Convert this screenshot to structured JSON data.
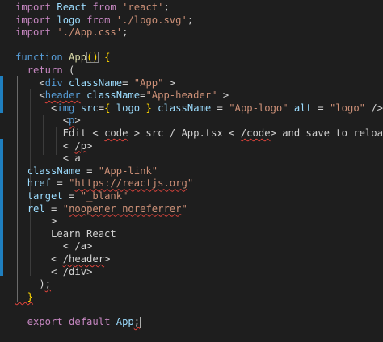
{
  "editor": {
    "language": "tsx",
    "colors": {
      "background": "#1e1e1e",
      "keyword_flow": "#c586c0",
      "keyword": "#569cd6",
      "string": "#ce9178",
      "function": "#dcdcaa",
      "attribute": "#9cdcfe",
      "text": "#d4d4d4",
      "error_squiggle": "#e0443c",
      "gutter_modified": "#1f7fbf"
    },
    "lines": [
      [
        {
          "t": "import ",
          "c": "kw-flow"
        },
        {
          "t": "React ",
          "c": "var"
        },
        {
          "t": "from ",
          "c": "kw-flow"
        },
        {
          "t": "'react'",
          "c": "str"
        },
        {
          "t": ";",
          "c": "punct"
        }
      ],
      [
        {
          "t": "import ",
          "c": "kw-flow"
        },
        {
          "t": "logo ",
          "c": "var"
        },
        {
          "t": "from ",
          "c": "kw-flow"
        },
        {
          "t": "'./logo.svg'",
          "c": "str"
        },
        {
          "t": ";",
          "c": "punct"
        }
      ],
      [
        {
          "t": "import ",
          "c": "kw-flow"
        },
        {
          "t": "'./App.css'",
          "c": "str"
        },
        {
          "t": ";",
          "c": "punct"
        }
      ],
      [],
      [
        {
          "t": "function ",
          "c": "kw"
        },
        {
          "t": "App",
          "c": "fn"
        },
        {
          "t": "()",
          "c": "brk bracket-match"
        },
        {
          "t": " ",
          "c": "txt"
        },
        {
          "t": "{",
          "c": "brk"
        }
      ],
      [
        {
          "t": "  return ",
          "c": "kw-flow"
        },
        {
          "t": "(",
          "c": "punct"
        }
      ],
      [
        {
          "t": "    <",
          "c": "punct"
        },
        {
          "t": "div ",
          "c": "tag"
        },
        {
          "t": "className",
          "c": "attr"
        },
        {
          "t": "= ",
          "c": "punct"
        },
        {
          "t": "\"App\"",
          "c": "str"
        },
        {
          "t": " >",
          "c": "punct"
        }
      ],
      [
        {
          "t": "    <",
          "c": "punct"
        },
        {
          "t": "header",
          "c": "tag squig"
        },
        {
          "t": " ",
          "c": "txt"
        },
        {
          "t": "className",
          "c": "attr"
        },
        {
          "t": "=",
          "c": "punct"
        },
        {
          "t": "\"App-header\"",
          "c": "str"
        },
        {
          "t": " >",
          "c": "punct"
        }
      ],
      [
        {
          "t": "      <",
          "c": "punct"
        },
        {
          "t": "img ",
          "c": "tag"
        },
        {
          "t": "src",
          "c": "attr"
        },
        {
          "t": "=",
          "c": "punct"
        },
        {
          "t": "{ ",
          "c": "brk"
        },
        {
          "t": "logo",
          "c": "var"
        },
        {
          "t": " }",
          "c": "brk"
        },
        {
          "t": " className",
          "c": "attr"
        },
        {
          "t": " = ",
          "c": "punct"
        },
        {
          "t": "\"App-logo\"",
          "c": "str"
        },
        {
          "t": " alt",
          "c": "attr"
        },
        {
          "t": " = ",
          "c": "punct"
        },
        {
          "t": "\"logo\"",
          "c": "str"
        },
        {
          "t": " />",
          "c": "punct"
        }
      ],
      [
        {
          "t": "        <",
          "c": "punct"
        },
        {
          "t": "p",
          "c": "tag squig"
        },
        {
          "t": ">",
          "c": "punct"
        }
      ],
      [
        {
          "t": "        Edit < ",
          "c": "txt"
        },
        {
          "t": "code",
          "c": "txt squig"
        },
        {
          "t": " > src / App.tsx < ",
          "c": "txt"
        },
        {
          "t": "/code",
          "c": "txt squig"
        },
        {
          "t": "> and save to reload.",
          "c": "txt"
        }
      ],
      [
        {
          "t": "        < ",
          "c": "txt"
        },
        {
          "t": "/p",
          "c": "txt squig"
        },
        {
          "t": ">",
          "c": "txt"
        }
      ],
      [
        {
          "t": "        < ",
          "c": "txt"
        },
        {
          "t": "a",
          "c": "txt"
        }
      ],
      [
        {
          "t": "  ",
          "c": "txt"
        },
        {
          "t": "className",
          "c": "attr"
        },
        {
          "t": " = ",
          "c": "punct"
        },
        {
          "t": "\"App-link\"",
          "c": "str"
        }
      ],
      [
        {
          "t": "  ",
          "c": "txt"
        },
        {
          "t": "href",
          "c": "attr"
        },
        {
          "t": " = ",
          "c": "punct"
        },
        {
          "t": "\"",
          "c": "str"
        },
        {
          "t": "https://reactjs.org",
          "c": "str squig"
        },
        {
          "t": "\"",
          "c": "str"
        }
      ],
      [
        {
          "t": "  ",
          "c": "txt"
        },
        {
          "t": "target",
          "c": "attr"
        },
        {
          "t": " = ",
          "c": "punct"
        },
        {
          "t": "\"_blank\"",
          "c": "str"
        }
      ],
      [
        {
          "t": "  ",
          "c": "txt"
        },
        {
          "t": "rel",
          "c": "attr"
        },
        {
          "t": " = ",
          "c": "punct"
        },
        {
          "t": "\"",
          "c": "str"
        },
        {
          "t": "noopener noreferrer",
          "c": "str squig"
        },
        {
          "t": "\"",
          "c": "str"
        }
      ],
      [
        {
          "t": "      >",
          "c": "txt"
        }
      ],
      [
        {
          "t": "      Learn React",
          "c": "txt"
        }
      ],
      [
        {
          "t": "        < ",
          "c": "txt"
        },
        {
          "t": "/a",
          "c": "txt"
        },
        {
          "t": ">",
          "c": "txt"
        }
      ],
      [
        {
          "t": "      < ",
          "c": "txt"
        },
        {
          "t": "/header",
          "c": "txt squig"
        },
        {
          "t": ">",
          "c": "txt"
        }
      ],
      [
        {
          "t": "      < ",
          "c": "txt"
        },
        {
          "t": "/div",
          "c": "txt"
        },
        {
          "t": ">",
          "c": "txt"
        }
      ],
      [
        {
          "t": "    )",
          "c": "punct"
        },
        {
          "t": ";",
          "c": "punct squig"
        }
      ],
      [
        {
          "t": "  }",
          "c": "brk squig"
        }
      ],
      [],
      [
        {
          "t": "  export ",
          "c": "kw-flow"
        },
        {
          "t": "default ",
          "c": "kw-flow"
        },
        {
          "t": "App",
          "c": "var"
        },
        {
          "t": ";",
          "c": "punct squig"
        },
        {
          "t": "",
          "c": "cursor-mark"
        }
      ]
    ]
  }
}
